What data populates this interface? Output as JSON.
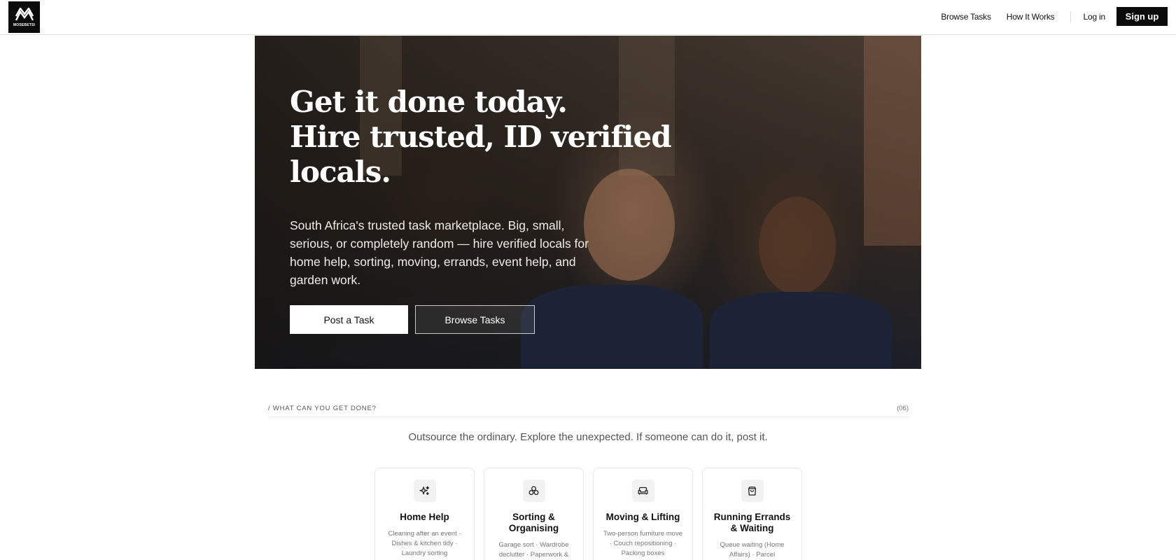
{
  "header": {
    "logo_text": "MOSEBETSI",
    "nav": {
      "browse_tasks": "Browse Tasks",
      "how_it_works": "How It Works",
      "log_in": "Log in",
      "sign_up": "Sign up"
    }
  },
  "hero": {
    "title_lines": [
      "Get it done today.",
      "Hire trusted, ID verified",
      "locals."
    ],
    "subtitle": "South Africa's trusted task marketplace. Big, small, serious, or completely random — hire verified locals for home help, sorting, moving, errands, event help, and garden work.",
    "post_task": "Post a Task",
    "browse_tasks": "Browse Tasks"
  },
  "section": {
    "label": "/  WHAT CAN YOU GET DONE?",
    "count": "(06)",
    "tagline": "Outsource the ordinary. Explore the unexpected. If someone can do it, post it."
  },
  "categories": [
    {
      "icon": "sparkles-icon",
      "title": "Home Help",
      "desc": "Cleaning after an event · Dishes & kitchen tidy · Laundry sorting"
    },
    {
      "icon": "boxes-icon",
      "title": "Sorting & Organising",
      "desc": "Garage sort · Wardrobe declutter · Paperwork & filing"
    },
    {
      "icon": "sofa-icon",
      "title": "Moving & Lifting",
      "desc": "Two-person furniture move · Couch repositioning · Packing boxes"
    },
    {
      "icon": "shopping-bag-icon",
      "title": "Running Errands & Waiting",
      "desc": "Queue waiting (Home Affairs) · Parcel"
    }
  ],
  "colors": {
    "accent": "#0b0b0b",
    "background": "#ffffff",
    "muted_text": "#555555"
  }
}
